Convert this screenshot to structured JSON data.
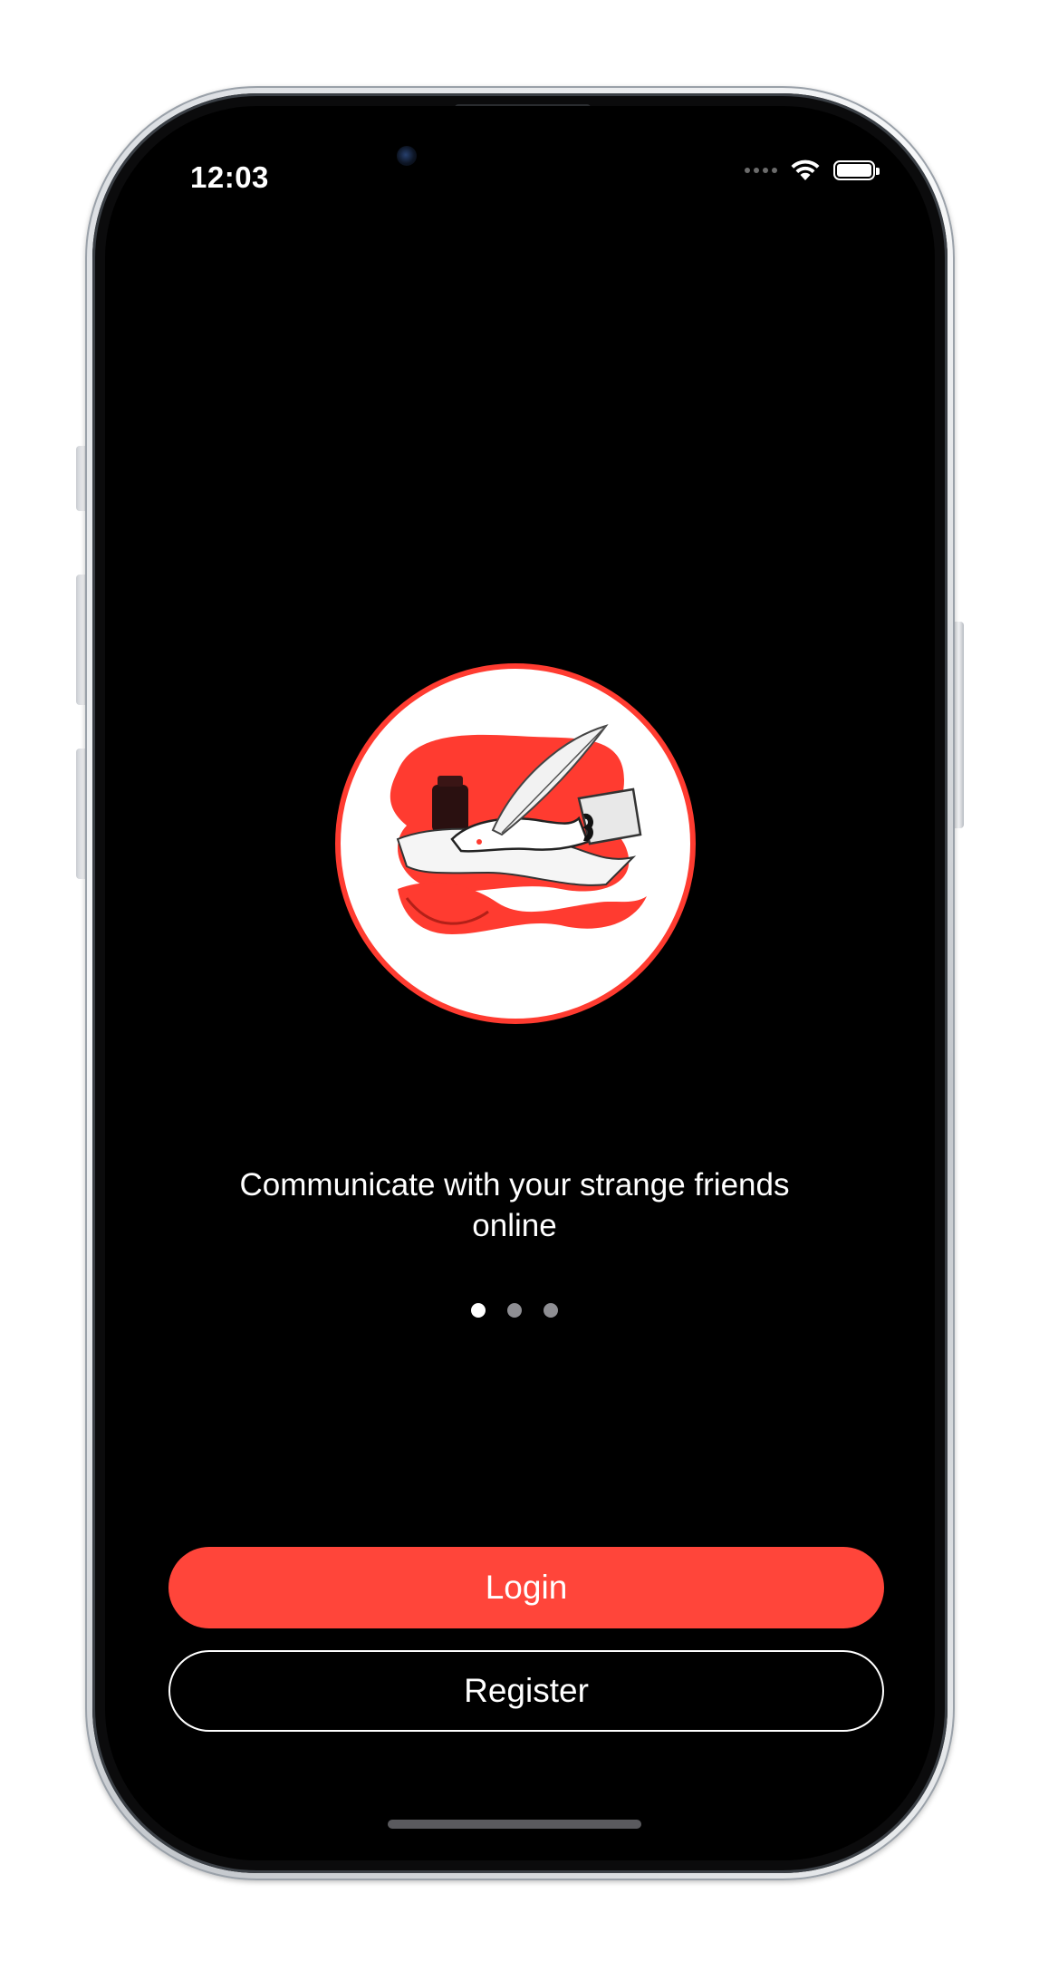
{
  "status_bar": {
    "time": "12:03",
    "battery_level": 1.0,
    "icons": [
      "cellular-signal-icon",
      "wifi-icon",
      "battery-icon"
    ]
  },
  "onboarding": {
    "logo_icon": "quill-writing-hand-icon",
    "tagline": "Communicate with your strange friends online",
    "pages_total": 3,
    "current_page": 1
  },
  "actions": {
    "login_label": "Login",
    "register_label": "Register"
  },
  "colors": {
    "accent": "#ff453a",
    "background": "#000000",
    "text": "#ffffff",
    "dot_inactive": "#8e8e93"
  }
}
